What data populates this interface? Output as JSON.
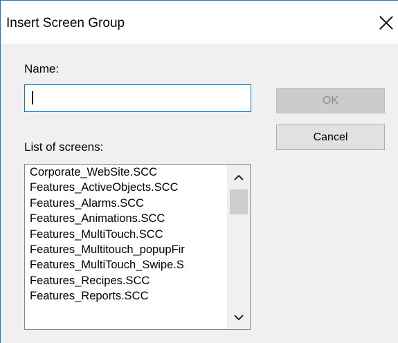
{
  "window": {
    "title": "Insert Screen Group"
  },
  "form": {
    "name_label": "Name:",
    "name_value": "",
    "list_label": "List of screens:"
  },
  "buttons": {
    "ok": "OK",
    "cancel": "Cancel"
  },
  "screens": [
    "Corporate_WebSite.SCC",
    "Features_ActiveObjects.SCC",
    "Features_Alarms.SCC",
    "Features_Animations.SCC",
    "Features_MultiTouch.SCC",
    "Features_Multitouch_popupFir",
    "Features_MultiTouch_Swipe.S",
    "Features_Recipes.SCC",
    "Features_Reports.SCC"
  ],
  "scrollbar": {
    "position": 0.0
  },
  "icons": {
    "close": "close-icon",
    "up": "chevron-up-icon",
    "down": "chevron-down-icon"
  }
}
